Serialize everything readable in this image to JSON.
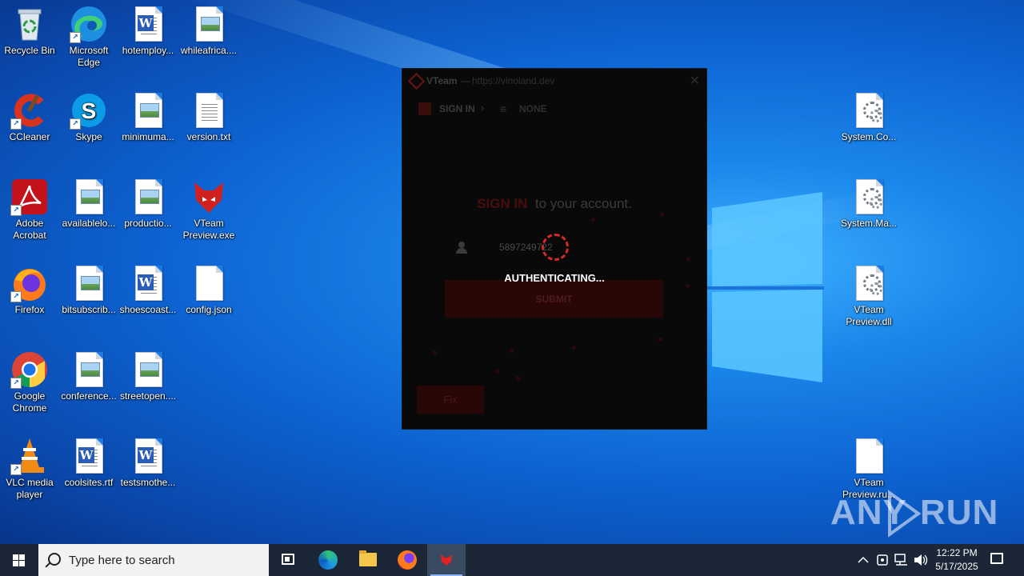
{
  "desktop": {
    "icons_col1": [
      {
        "label": "Recycle Bin",
        "icon": "recycle-bin-icon"
      },
      {
        "label": "CCleaner",
        "icon": "ccleaner-icon"
      },
      {
        "label": "Adobe Acrobat",
        "icon": "adobe-acrobat-icon"
      },
      {
        "label": "Firefox",
        "icon": "firefox-icon"
      },
      {
        "label": "Google Chrome",
        "icon": "chrome-icon"
      },
      {
        "label": "VLC media player",
        "icon": "vlc-icon"
      }
    ],
    "icons_col2": [
      {
        "label": "Microsoft Edge",
        "icon": "edge-icon"
      },
      {
        "label": "Skype",
        "icon": "skype-icon"
      },
      {
        "label": "availablelo...",
        "icon": "image-file-icon"
      },
      {
        "label": "bitsubscrib...",
        "icon": "image-file-icon"
      },
      {
        "label": "conference...",
        "icon": "image-file-icon"
      },
      {
        "label": "coolsites.rtf",
        "icon": "word-file-icon"
      }
    ],
    "icons_col3": [
      {
        "label": "hotemploy...",
        "icon": "word-file-icon"
      },
      {
        "label": "minimuma...",
        "icon": "image-file-icon"
      },
      {
        "label": "productio...",
        "icon": "image-file-icon"
      },
      {
        "label": "shoescoast...",
        "icon": "word-file-icon"
      },
      {
        "label": "streetopen....",
        "icon": "image-file-icon"
      },
      {
        "label": "testsmothe...",
        "icon": "word-file-icon"
      }
    ],
    "icons_col4": [
      {
        "label": "whileafrica....",
        "icon": "image-file-icon"
      },
      {
        "label": "version.txt",
        "icon": "text-file-icon"
      },
      {
        "label": "VTeam Preview.exe",
        "icon": "vteam-icon"
      },
      {
        "label": "config.json",
        "icon": "blank-file-icon"
      }
    ],
    "icons_right": [
      {
        "label": "System.Co...",
        "icon": "dll-file-icon"
      },
      {
        "label": "System.Ma...",
        "icon": "dll-file-icon"
      },
      {
        "label": "VTeam Preview.dll",
        "icon": "dll-file-icon"
      },
      {
        "label": "VTeam Preview.ru...",
        "icon": "blank-file-icon"
      }
    ]
  },
  "vteam_window": {
    "app_name": "VTeam",
    "separator": "—",
    "url": "https://vinoland.dev",
    "close": "✕",
    "nav_signin": "SIGN IN",
    "nav_chevron": "›",
    "nav_list": "≡",
    "nav_none": "NONE",
    "heading_red": "SIGN IN",
    "heading_rest": "to your account.",
    "username_value": "5897249722",
    "submit_label": "SUBMIT",
    "fix_label": "Fix",
    "overlay_text": "AUTHENTICATING...",
    "accent_color": "#d12a2a"
  },
  "taskbar": {
    "search_placeholder": "Type here to search",
    "time": "12:22 PM",
    "date": "5/17/2025",
    "tray_chevron": "^",
    "tray_network": "network-icon",
    "tray_volume": "volume-icon"
  },
  "watermark": {
    "left": "ANY",
    "right": "RUN"
  }
}
